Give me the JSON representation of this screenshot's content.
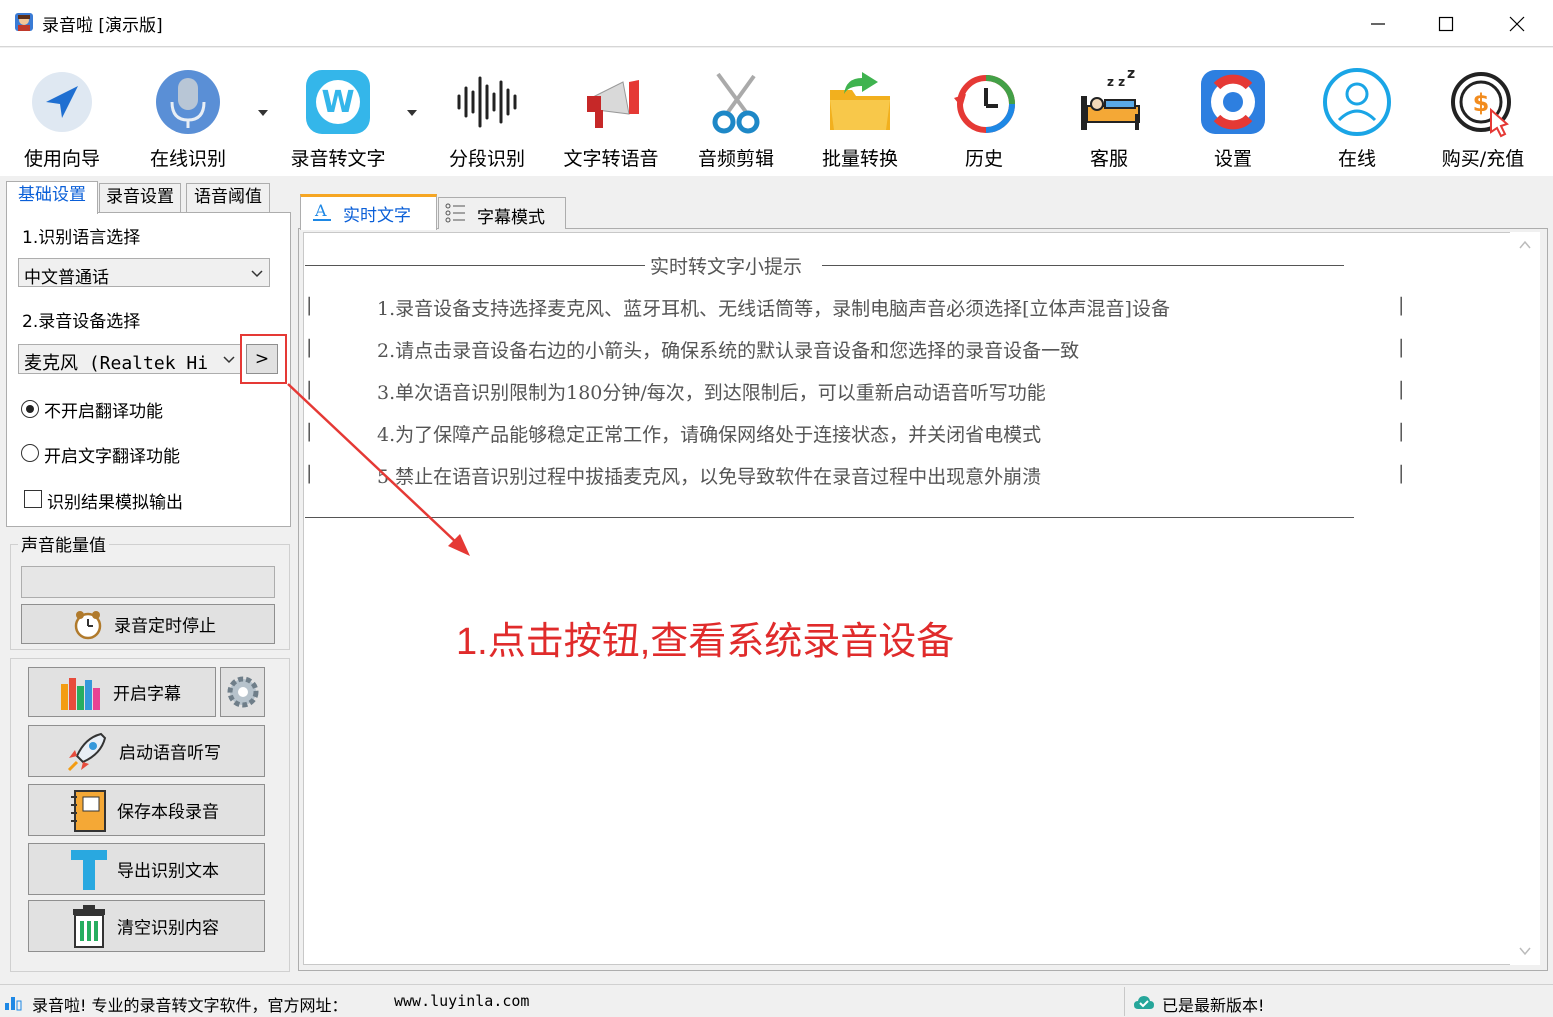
{
  "window": {
    "title": "录音啦 [演示版]",
    "controls": {
      "minimize": "minimize",
      "maximize": "maximize",
      "close": "close"
    }
  },
  "toolbar": {
    "items": [
      {
        "label": "使用向导",
        "icon": "navigation-arrow-icon"
      },
      {
        "label": "在线识别",
        "icon": "microphone-icon"
      },
      {
        "label": "录音转文字",
        "icon": "w-logo-icon"
      },
      {
        "label": "分段识别",
        "icon": "waveform-icon"
      },
      {
        "label": "文字转语音",
        "icon": "megaphone-icon"
      },
      {
        "label": "音频剪辑",
        "icon": "scissors-icon"
      },
      {
        "label": "批量转换",
        "icon": "folder-icon"
      },
      {
        "label": "历史",
        "icon": "history-clock-icon"
      },
      {
        "label": "客服",
        "icon": "sleeping-bed-icon"
      },
      {
        "label": "设置",
        "icon": "lifebuoy-icon"
      },
      {
        "label": "在线",
        "icon": "user-circle-icon"
      },
      {
        "label": "购买/充值",
        "icon": "dollar-coin-icon"
      }
    ]
  },
  "left_tabs": [
    "基础设置",
    "录音设置",
    "语音阈值"
  ],
  "basic": {
    "lang_label": "1.识别语言选择",
    "lang_value": "中文普通话",
    "device_label": "2.录音设备选择",
    "device_value": "麦克风 (Realtek Hi",
    "device_more": ">",
    "radio_off": "不开启翻译功能",
    "radio_on": "开启文字翻译功能",
    "checkbox_sim": "识别结果模拟输出"
  },
  "energy": {
    "label": "声音能量值",
    "level": 0,
    "timer_button": "录音定时停止"
  },
  "actions": {
    "subtitle": "开启字幕",
    "dictation": "启动语音听写",
    "save": "保存本段录音",
    "export": "导出识别文本",
    "clear": "清空识别内容"
  },
  "right_tabs": [
    "实时文字",
    "字幕模式"
  ],
  "tips": {
    "title": "实时转文字小提示",
    "lines": [
      "1.录音设备支持选择麦克风、蓝牙耳机、无线话筒等，录制电脑声音必须选择[立体声混音]设备",
      "2.请点击录音设备右边的小箭头，确保系统的默认录音设备和您选择的录音设备一致",
      "3.单次语音识别限制为180分钟/每次，到达限制后，可以重新启动语音听写功能",
      "4.为了保障产品能够稳定正常工作，请确保网络处于连接状态，并关闭省电模式",
      "5.禁止在语音识别过程中拔插麦克风，以免导致软件在录音过程中出现意外崩溃"
    ]
  },
  "annotation": "1.点击按钮,查看系统录音设备",
  "status": {
    "left_prefix": "录音啦! 专业的录音转文字软件，官方网址：",
    "left_url": "www.luyinla.com",
    "right": "已是最新版本!"
  },
  "colors": {
    "accent_blue": "#0a5fd8",
    "annotation_red": "#e02b2b",
    "tab_highlight": "#f6a623"
  }
}
